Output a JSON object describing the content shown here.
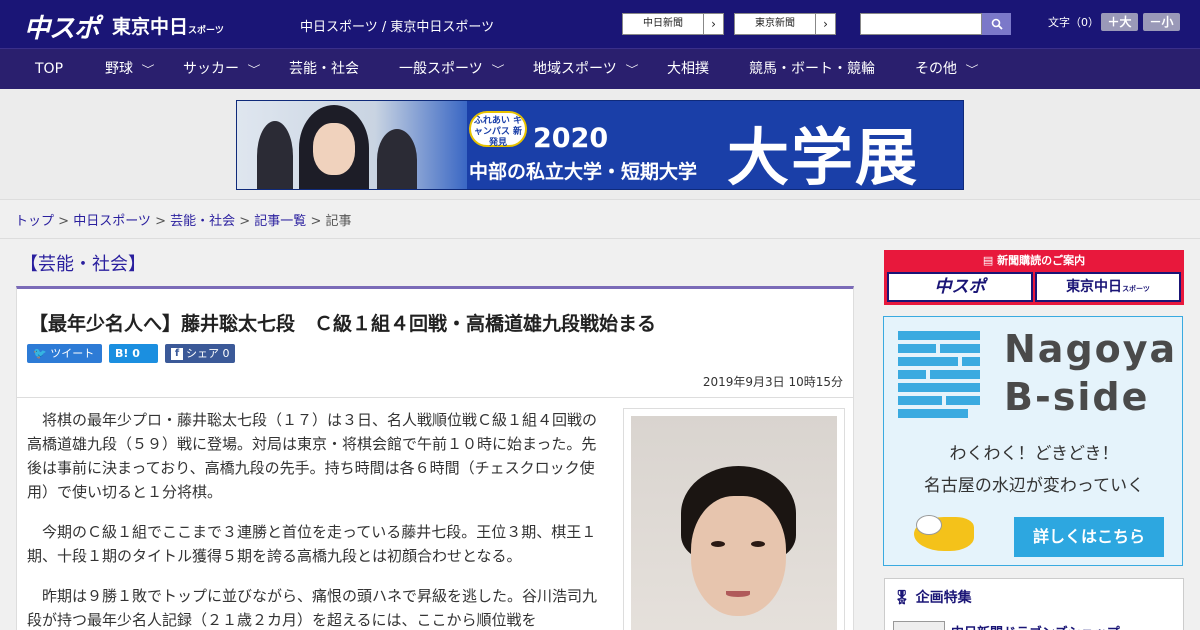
{
  "header": {
    "logo_primary": "中スポ",
    "logo_secondary": "東京中日",
    "logo_secondary_small": "スポーツ",
    "site_subtitle": "中日スポーツ / 東京中日スポーツ",
    "paper_links": [
      "中日新聞",
      "東京新聞"
    ],
    "paper_link_arrow": "›",
    "search_placeholder": "",
    "font_size_label": "文字（0）",
    "font_bigger": "＋大",
    "font_smaller": "－小"
  },
  "nav": {
    "items": [
      "TOP",
      "野球",
      "サッカー",
      "芸能・社会",
      "一般スポーツ",
      "地域スポーツ",
      "大相撲",
      "競馬・ボート・競輪",
      "その他"
    ],
    "chevron": "﹀"
  },
  "ad_banner": {
    "badge": "ふれあい キャンパス 新発見",
    "year": "2020",
    "subtitle": "中部の私立大学・短期大学",
    "main": "大学展"
  },
  "breadcrumb": {
    "items": [
      "トップ",
      "中日スポーツ",
      "芸能・社会",
      "記事一覧"
    ],
    "current": "記事",
    "separator": " > "
  },
  "article": {
    "category": "【芸能・社会】",
    "title": "【最年少名人へ】藤井聡太七段　Ｃ級１組４回戦・高橋道雄九段戦始まる",
    "share_tweet": "ツイート",
    "share_hatena": "B! 0",
    "share_facebook": "シェア 0",
    "date": "2019年9月3日 10時15分",
    "paragraphs": [
      "将棋の最年少プロ・藤井聡太七段（１７）は３日、名人戦順位戦Ｃ級１組４回戦の高橋道雄九段（５９）戦に登場。対局は東京・将棋会館で午前１０時に始まった。先後は事前に決まっており、高橋九段の先手。持ち時間は各６時間（チェスクロック使用）で使い切ると１分将棋。",
      "今期のＣ級１組でここまで３連勝と首位を走っている藤井七段。王位３期、棋王１期、十段１期のタイトル獲得５期を誇る高橋九段とは初顔合わせとなる。",
      "昨期は９勝１敗でトップに並びながら、痛恨の頭ハネで昇級を逃した。谷川浩司九段が持つ最年少名人記録（２１歳２カ月）を超えるには、ここから順位戦を"
    ]
  },
  "sidebar": {
    "subscribe_title": "新聞購読のご案内",
    "subscribe_buttons": [
      "中スポ",
      "東京中日"
    ],
    "subscribe_small": "スポーツ",
    "nagoya_title_line1": "Nagoya",
    "nagoya_title_line2": "B-side",
    "nagoya_text1": "わくわく！どきどき！",
    "nagoya_text2": "名古屋の水辺が変わっていく",
    "nagoya_button": "詳しくはこちら",
    "feature_title": "企画特集",
    "feature_item": "中日新聞ドラゴンズショップ"
  },
  "colors": {
    "header_bg": "#1a1576",
    "nav_bg": "#2a1f6e",
    "link": "#2a1f9e",
    "subscribe_red": "#e8183c",
    "nagoya_blue": "#3aaae0"
  }
}
